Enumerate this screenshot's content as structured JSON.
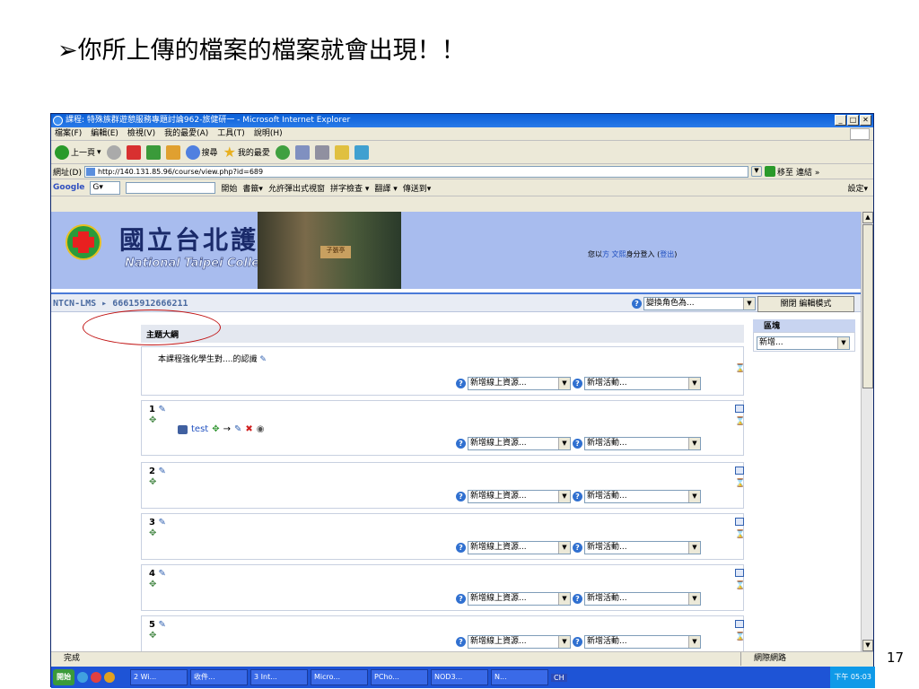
{
  "slide": {
    "title": "➢你所上傳的檔案的檔案就會出現！！",
    "number": "17"
  },
  "window": {
    "title": "課程: 特殊族群遊憩服務專題討論962-旅健研一 - Microsoft Internet Explorer",
    "btn_min": "_",
    "btn_max": "□",
    "btn_close": "✕"
  },
  "menu": [
    "檔案(F)",
    "編輯(E)",
    "檢視(V)",
    "我的最愛(A)",
    "工具(T)",
    "說明(H)"
  ],
  "toolbar": {
    "back": "上一頁",
    "search": "搜尋",
    "favorites": "我的最愛"
  },
  "address": {
    "label": "網址(D)",
    "url": "http://140.131.85.96/course/view.php?id=689",
    "go": "移至",
    "links": "連結"
  },
  "google": {
    "logo": "Google",
    "g": "G▾",
    "start": "開始",
    "bookmarks": "書籤▾",
    "popup": "允許彈出式視窗",
    "spell": "拼字檢查 ▾",
    "translate": "翻譯 ▾",
    "send": "傳送到▾",
    "settings": "設定▾"
  },
  "page": {
    "school_cn": "國立台北護理學院",
    "school_en": "National Taipei College of Nursing",
    "sign": "子張亭",
    "login_prefix": "您以",
    "login_user": "方 文熙",
    "login_mid": "身分登入 (",
    "login_logout": "登出",
    "login_suffix": ")",
    "breadcrumb": "NTCN-LMS ▸ 66615912666211",
    "role_select": "變換角色為...",
    "edit_button": "關閉 編輯模式",
    "topic_header": "主題大綱",
    "section0_text": "本課程強化學生對....的認識",
    "add_resource": "新增線上資源...",
    "add_activity": "新增活動...",
    "section_nums": [
      "1",
      "2",
      "3",
      "4",
      "5"
    ],
    "test_item": "test",
    "block_title": "區塊",
    "block_select": "新增..."
  },
  "status": {
    "left": "完成",
    "right": "網際網路"
  },
  "taskbar": {
    "start": "開始",
    "items": [
      "2 Wi...",
      "收件...",
      "3 Int...",
      "Micro...",
      "PCho...",
      "NOD3...",
      "N..."
    ],
    "lang": "CH",
    "clock": "下午 05:03"
  }
}
